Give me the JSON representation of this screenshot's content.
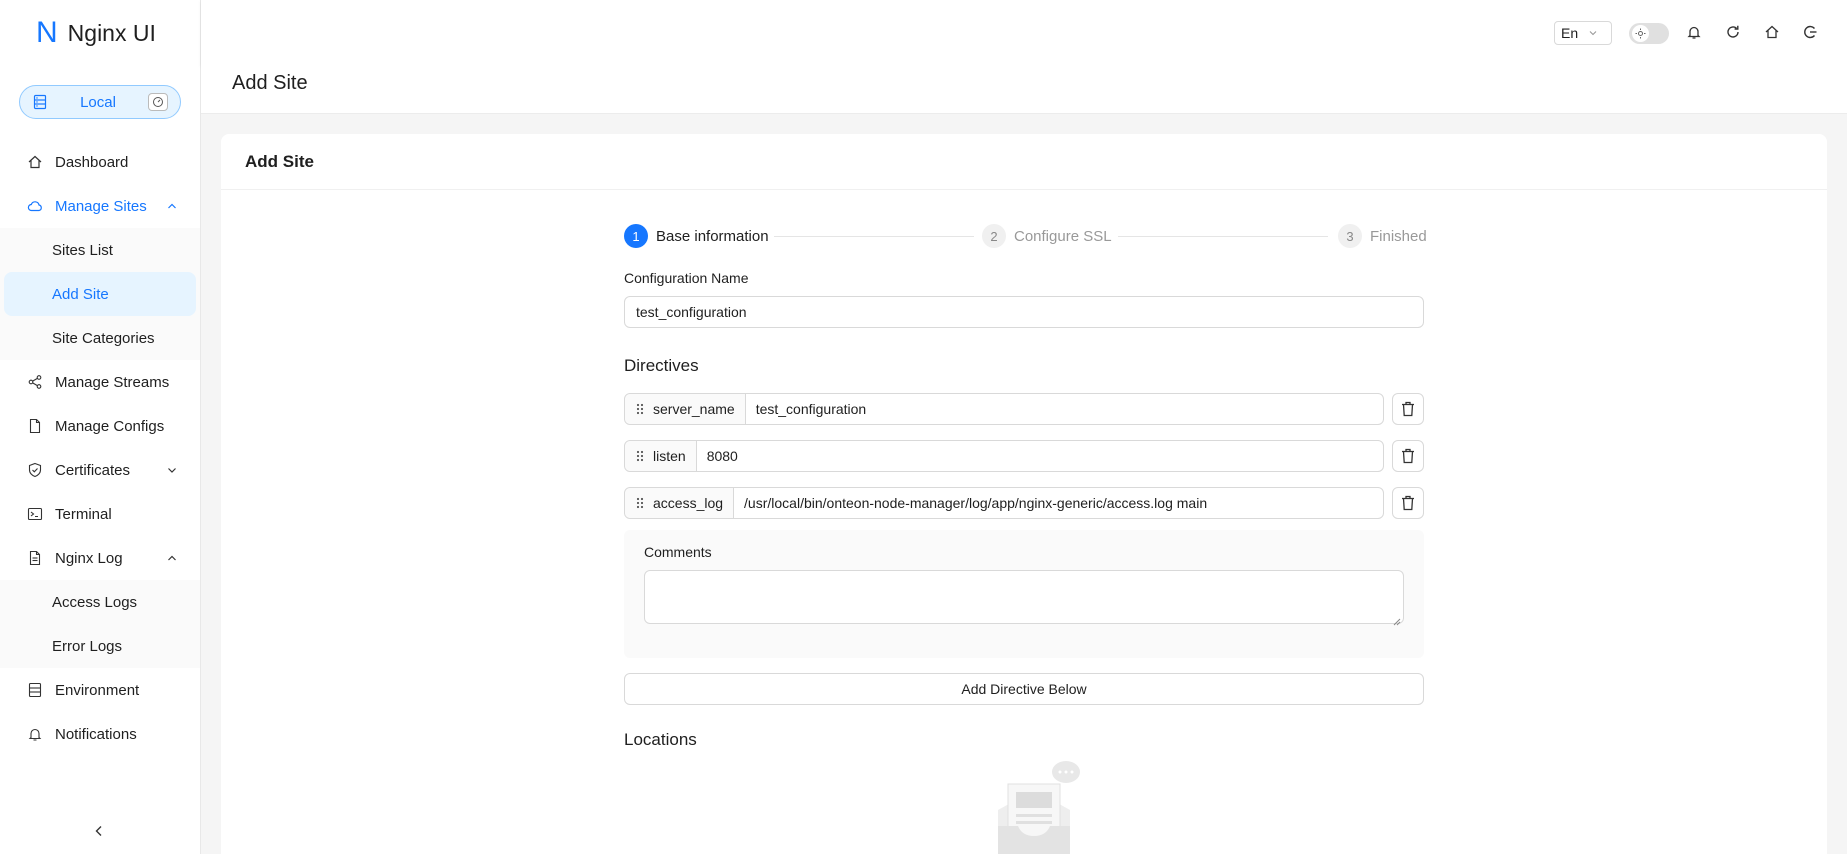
{
  "app": {
    "logo_letter": "N",
    "name": "Nginx UI"
  },
  "environment": {
    "label": "Local"
  },
  "sidebar": {
    "items": [
      {
        "label": "Dashboard",
        "icon": "home-icon"
      },
      {
        "label": "Manage Sites",
        "icon": "cloud-icon",
        "open": true,
        "children": [
          {
            "label": "Sites List"
          },
          {
            "label": "Add Site",
            "active": true
          },
          {
            "label": "Site Categories"
          }
        ]
      },
      {
        "label": "Manage Streams",
        "icon": "share-icon"
      },
      {
        "label": "Manage Configs",
        "icon": "file-icon"
      },
      {
        "label": "Certificates",
        "icon": "safety-icon"
      },
      {
        "label": "Terminal",
        "icon": "terminal-icon"
      },
      {
        "label": "Nginx Log",
        "icon": "file-text-icon",
        "open": true,
        "children": [
          {
            "label": "Access Logs"
          },
          {
            "label": "Error Logs"
          }
        ]
      },
      {
        "label": "Environment",
        "icon": "database-icon"
      },
      {
        "label": "Notifications",
        "icon": "bell-icon"
      }
    ]
  },
  "header": {
    "language": "En",
    "icons": [
      "sun-icon",
      "bell-icon",
      "reload-icon",
      "home-icon",
      "logout-icon"
    ]
  },
  "page": {
    "title": "Add Site",
    "card_title": "Add Site"
  },
  "steps": [
    {
      "num": "1",
      "label": "Base information",
      "status": "active"
    },
    {
      "num": "2",
      "label": "Configure SSL",
      "status": "wait"
    },
    {
      "num": "3",
      "label": "Finished",
      "status": "wait"
    }
  ],
  "form": {
    "config_name_label": "Configuration Name",
    "config_name_value": "test_configuration",
    "directives_title": "Directives",
    "directives": [
      {
        "name": "server_name",
        "value": "test_configuration"
      },
      {
        "name": "listen",
        "value": "8080"
      },
      {
        "name": "access_log",
        "value": "/usr/local/bin/onteon-node-manager/log/app/nginx-generic/access.log main"
      }
    ],
    "comments_label": "Comments",
    "comments_value": "",
    "add_directive_label": "Add Directive Below",
    "locations_title": "Locations"
  },
  "colors": {
    "accent": "#1677ff",
    "accent_bg": "#e6f4ff"
  }
}
